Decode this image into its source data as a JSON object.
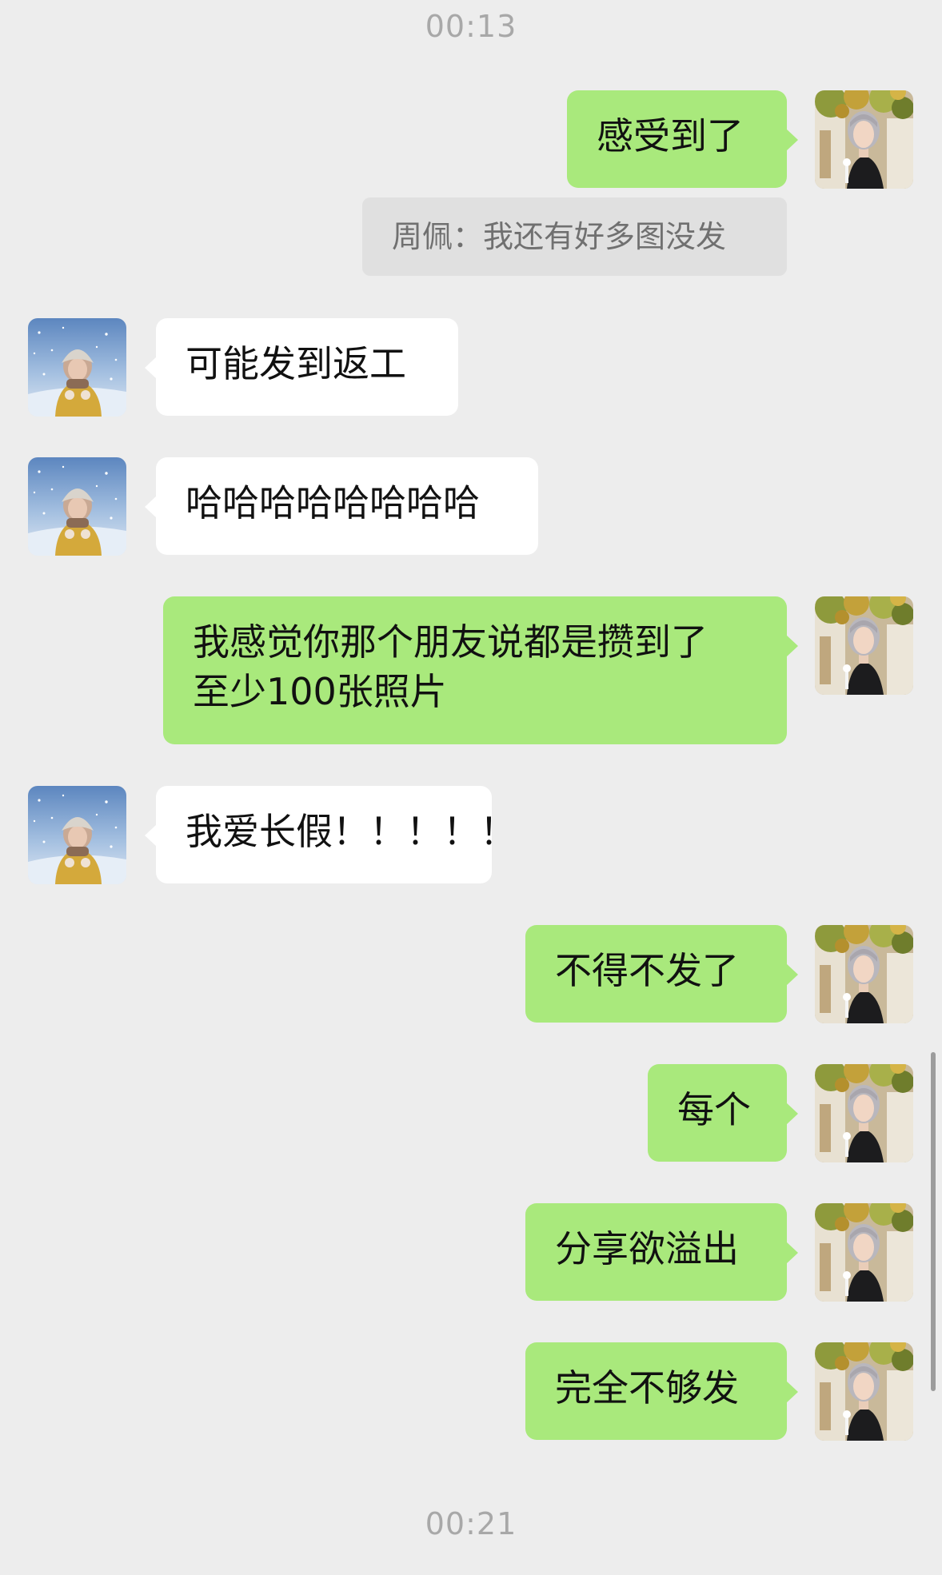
{
  "chat": {
    "timestamps": [
      "00:13",
      "00:21"
    ],
    "messages": [
      {
        "side": "right",
        "text": "感受到了"
      },
      {
        "side": "right",
        "quote": "周佩：我还有好多图没发"
      },
      {
        "side": "left",
        "text": "可能发到返工"
      },
      {
        "side": "left",
        "text": "哈哈哈哈哈哈哈哈"
      },
      {
        "side": "right",
        "lines": [
          "我感觉你那个朋友说都是攒到了",
          "至少100张照片"
        ]
      },
      {
        "side": "left",
        "text": "我爱长假！！！！！"
      },
      {
        "side": "right",
        "text": "不得不发了"
      },
      {
        "side": "right",
        "text": "每个"
      },
      {
        "side": "right",
        "text": "分享欲溢出"
      },
      {
        "side": "right",
        "text": "完全不够发"
      }
    ]
  },
  "colors": {
    "background": "#ededed",
    "sent_bubble": "#a9e97c",
    "received_bubble": "#ffffff",
    "quote_background": "#e0e0e0",
    "timestamp_text": "#a8a8a8"
  },
  "icons": {
    "my_avatar": "avatar-photo-woman-autumn",
    "friend_avatar": "avatar-photo-snow"
  }
}
